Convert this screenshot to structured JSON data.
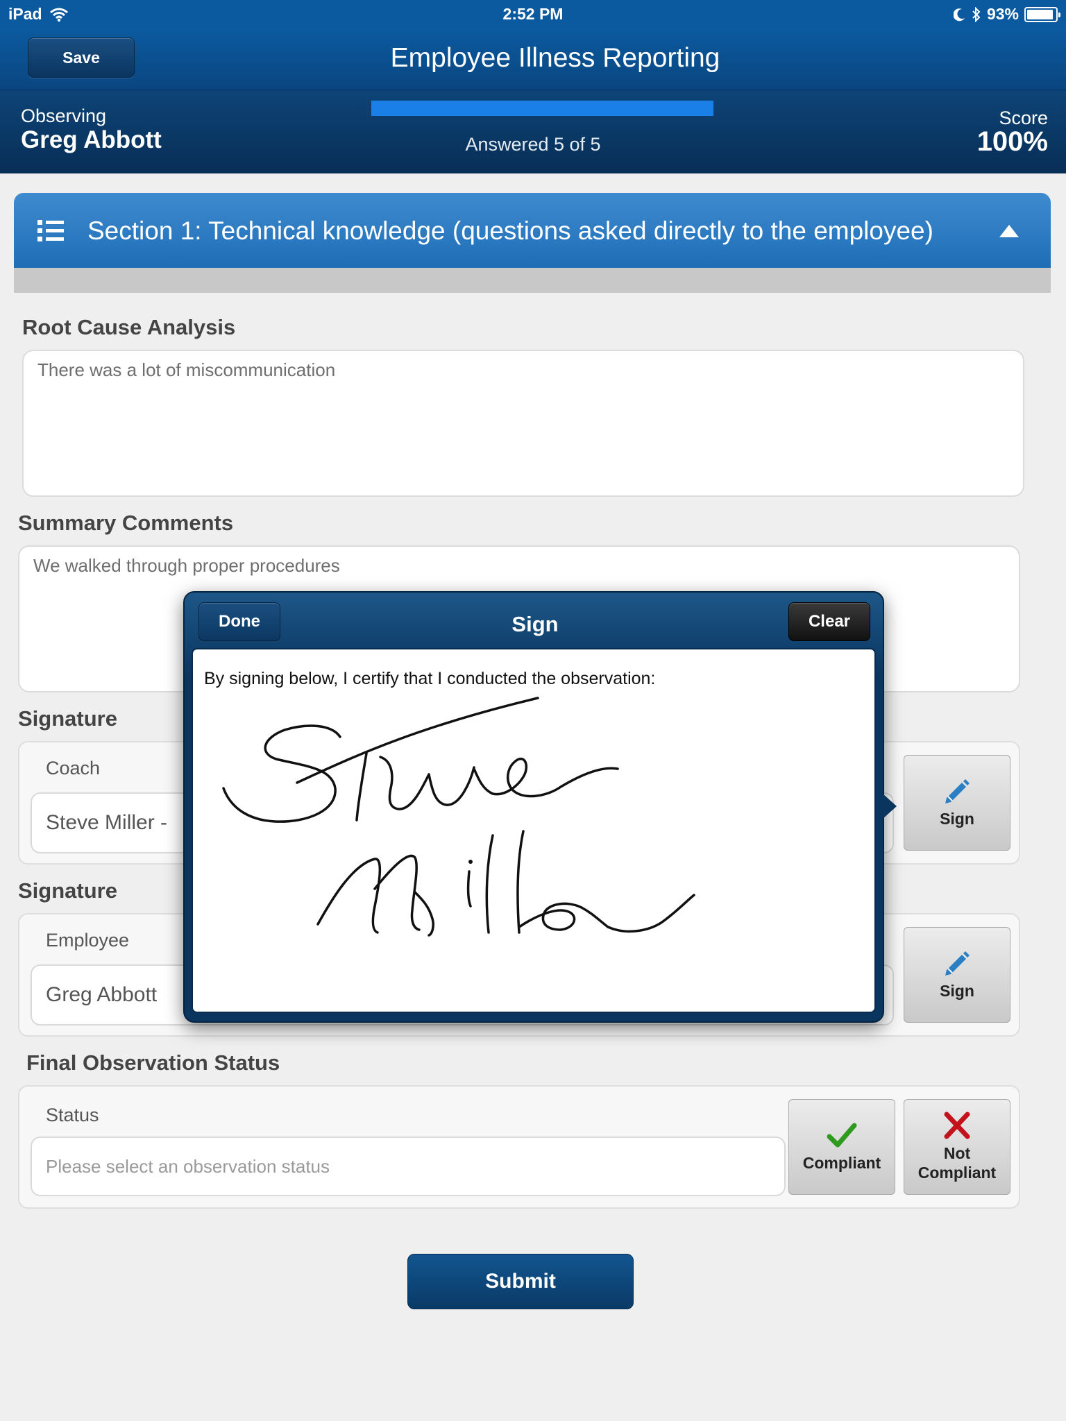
{
  "status_bar": {
    "device": "iPad",
    "time": "2:52 PM",
    "battery": "93%",
    "battery_level": 0.93
  },
  "nav": {
    "save_label": "Save",
    "title": "Employee Illness Reporting"
  },
  "info": {
    "observing_label": "Observing",
    "observing_name": "Greg Abbott",
    "progress_fraction": 1.0,
    "answered_text": "Answered 5 of 5",
    "score_label": "Score",
    "score_value": "100%"
  },
  "section": {
    "title": "Section 1: Technical knowledge (questions asked directly to the employee)"
  },
  "root_cause": {
    "label": "Root Cause Analysis",
    "value": "There was a lot of miscommunication"
  },
  "summary": {
    "label": "Summary Comments",
    "value": "We walked through proper procedures"
  },
  "signature_coach": {
    "label": "Signature",
    "sub_label": "Coach",
    "value": "Steve Miller -",
    "sign_label": "Sign"
  },
  "signature_employee": {
    "label": "Signature",
    "sub_label": "Employee",
    "value": "Greg Abbott",
    "sign_label": "Sign"
  },
  "final_status": {
    "label": "Final Observation Status",
    "sub_label": "Status",
    "placeholder": "Please select an observation status",
    "compliant_label": "Compliant",
    "not_compliant_label": "Not Compliant"
  },
  "submit_label": "Submit",
  "sign_popover": {
    "done_label": "Done",
    "title": "Sign",
    "clear_label": "Clear",
    "certify_text": "By signing below, I certify that I conducted the observation:"
  },
  "colors": {
    "nav_blue": "#0b5aa0",
    "header_dark": "#082e56",
    "section_blue": "#2a78bf",
    "progress_fill": "#1b7fe8",
    "check_green": "#2e9a1e",
    "x_red": "#c4121c",
    "pencil_blue": "#2a7fc4"
  }
}
